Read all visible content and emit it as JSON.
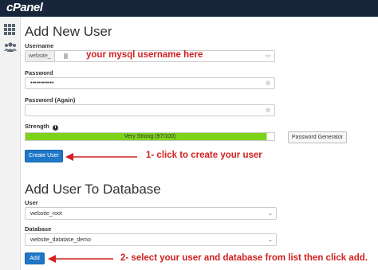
{
  "app": {
    "logo": "cPanel"
  },
  "sidebar": {
    "icons": [
      "grid-icon",
      "users-icon"
    ]
  },
  "add_user": {
    "title": "Add New User",
    "username_label": "Username",
    "username_prefix": "website_",
    "password_label": "Password",
    "password_value": "••••••••••••",
    "password_again_label": "Password (Again)",
    "password_again_value": "",
    "strength_label": "Strength",
    "strength_text": "Very Strong (97/100)",
    "strength_percent": 97,
    "generator_button": "Password Generator",
    "create_button": "Create User"
  },
  "add_to_db": {
    "title": "Add User To Database",
    "user_label": "User",
    "user_value": "website_root",
    "database_label": "Database",
    "database_value": "website_datatase_demo",
    "add_button": "Add"
  },
  "annotations": {
    "username_note": "your mysql username here",
    "create_note": "1- click to create your user",
    "add_note": "2- select your user and database from list then click add."
  },
  "colors": {
    "topbar": "#17263a",
    "strength": "#7dd31a",
    "primary": "#1f78c7",
    "annotation": "#d32020"
  }
}
